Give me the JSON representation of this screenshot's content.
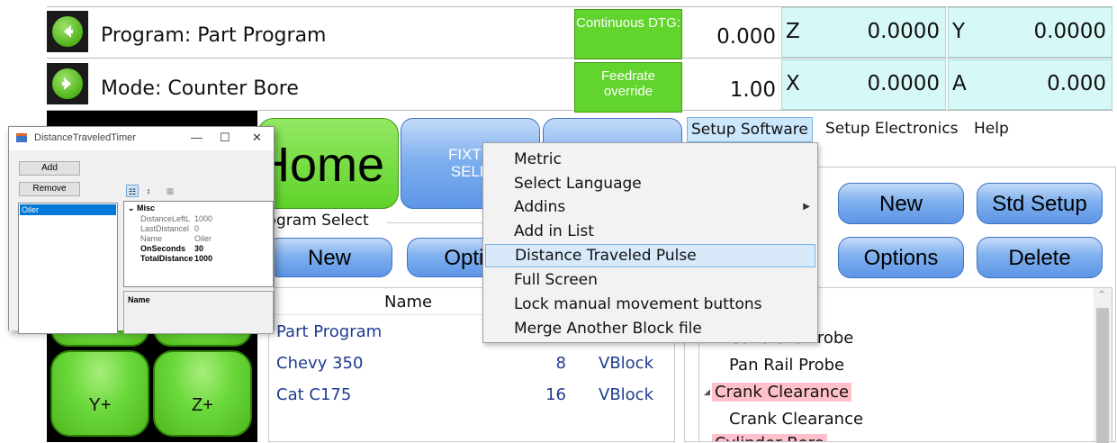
{
  "header": {
    "program_label": "Program: Part Program",
    "mode_label": "Mode: Counter Bore",
    "continuous_btn": "Continuous DTG:",
    "feedrate_btn": "Feedrate override",
    "dtg_value": "0.000",
    "feedrate_value": "1.00",
    "axes": [
      {
        "letter": "Z",
        "value": "0.0000"
      },
      {
        "letter": "Y",
        "value": "0.0000"
      },
      {
        "letter": "X",
        "value": "0.0000"
      },
      {
        "letter": "A",
        "value": "0.000"
      }
    ]
  },
  "buttons": {
    "home": "Home",
    "fixture": "FIXTU\nSELE",
    "new_left": "New",
    "options_left": "Optio",
    "new_right": "New",
    "std_setup": "Std Setup",
    "options_right": "Options",
    "delete": "Delete",
    "y_plus": "Y+",
    "z_plus": "Z+"
  },
  "program_select": {
    "legend": "rogram Select",
    "column_name": "Name",
    "rows": [
      {
        "name": "Part Program",
        "count": "",
        "type": ""
      },
      {
        "name": "Chevy 350",
        "count": "8",
        "type": "VBlock"
      },
      {
        "name": "Cat C175",
        "count": "16",
        "type": "VBlock"
      }
    ]
  },
  "menubar": {
    "items": [
      "Setup Software",
      "Setup Electronics",
      "Help"
    ]
  },
  "context_menu": {
    "items": [
      "Metric",
      "Select Language",
      "Addins",
      "Add in List",
      "Distance Traveled Pulse",
      "Full Screen",
      "Lock manual movement buttons",
      "Merge Another Block file"
    ],
    "selected_index": 4
  },
  "tree": {
    "items": [
      {
        "text": "Calibrate Probe",
        "level": 1,
        "highlight": false
      },
      {
        "text": "Pan Rail Probe",
        "level": 1,
        "highlight": false
      },
      {
        "text": "Crank Clearance",
        "level": 0,
        "highlight": true
      },
      {
        "text": "Crank Clearance",
        "level": 1,
        "highlight": false
      },
      {
        "text": "Cylinder Bore",
        "level": 0,
        "highlight": true
      }
    ]
  },
  "dialog": {
    "title": "DistanceTraveledTimer",
    "add_btn": "Add",
    "remove_btn": "Remove",
    "list_items": [
      "Oiler"
    ],
    "category": "Misc",
    "properties": [
      {
        "key": "DistanceLeftL",
        "value": "1000",
        "bold": false
      },
      {
        "key": "LastDistancel",
        "value": "0",
        "bold": false
      },
      {
        "key": "Name",
        "value": "Oiler",
        "bold": false
      },
      {
        "key": "OnSeconds",
        "value": "30",
        "bold": true
      },
      {
        "key": "TotalDistance",
        "value": "1000",
        "bold": true
      }
    ],
    "description_title": "Name"
  },
  "colors": {
    "green": "#61d42d",
    "blue": "#6ea3ea",
    "cyan_cell": "#d6f8f6",
    "highlight_pink": "#ffc0cb",
    "link_blue": "#1f3b8f"
  }
}
